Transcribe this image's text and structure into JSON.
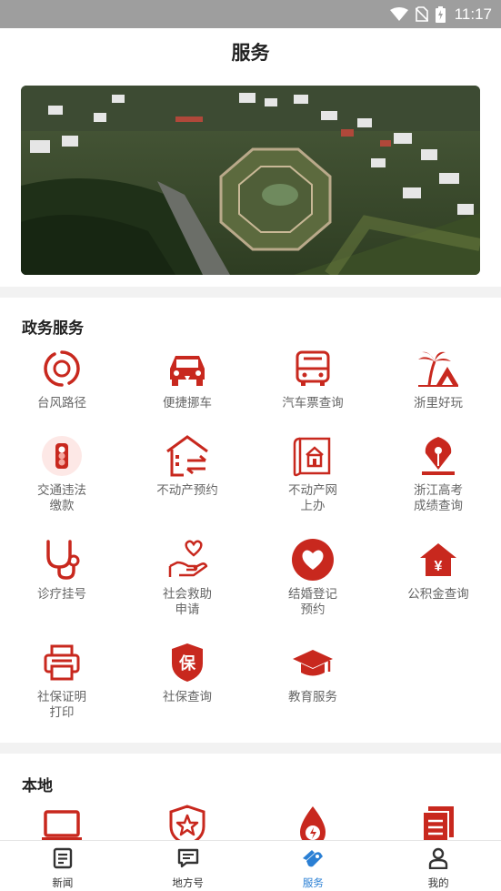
{
  "status_bar": {
    "time": "11:17",
    "icons": [
      "wifi-icon",
      "no-sim-icon",
      "battery-charging-icon"
    ]
  },
  "header": {
    "title": "服务"
  },
  "banner": {
    "alt": ""
  },
  "gov_section": {
    "title": "政务服务",
    "items": [
      {
        "label": "台风路径",
        "icon": "typhoon-icon"
      },
      {
        "label": "便捷挪车",
        "icon": "car-icon"
      },
      {
        "label": "汽车票查询",
        "icon": "bus-icon"
      },
      {
        "label": "浙里好玩",
        "icon": "palm-island-icon"
      },
      {
        "label": "交通违法\n缴款",
        "icon": "traffic-light-icon"
      },
      {
        "label": "不动产预约",
        "icon": "house-exchange-icon"
      },
      {
        "label": "不动产网\n上办",
        "icon": "property-doc-icon"
      },
      {
        "label": "浙江高考\n成绩查询",
        "icon": "pen-nib-icon"
      },
      {
        "label": "诊疗挂号",
        "icon": "stethoscope-icon"
      },
      {
        "label": "社会救助\n申请",
        "icon": "heart-hand-icon"
      },
      {
        "label": "结婚登记\n预约",
        "icon": "heart-circle-icon"
      },
      {
        "label": "公积金查询",
        "icon": "house-yuan-icon"
      },
      {
        "label": "社保证明\n打印",
        "icon": "printer-icon"
      },
      {
        "label": "社保查询",
        "icon": "shield-bao-icon"
      },
      {
        "label": "教育服务",
        "icon": "graduation-cap-icon"
      }
    ],
    "shield_char": "保",
    "yuan_char": "¥"
  },
  "local_section": {
    "title": "本地",
    "items": [
      {
        "icon": "laptop-icon"
      },
      {
        "icon": "star-shield-icon"
      },
      {
        "icon": "flame-drop-icon"
      },
      {
        "icon": "documents-icon"
      }
    ]
  },
  "tabbar": {
    "tabs": [
      {
        "label": "新闻",
        "icon": "news-icon",
        "active": false
      },
      {
        "label": "地方号",
        "icon": "chat-icon",
        "active": false
      },
      {
        "label": "服务",
        "icon": "service-icon",
        "active": true
      },
      {
        "label": "我的",
        "icon": "person-icon",
        "active": false
      }
    ]
  },
  "colors": {
    "accent_red": "#c8281e",
    "tab_active": "#2a7fd4",
    "status_bar": "#9e9e9e"
  }
}
